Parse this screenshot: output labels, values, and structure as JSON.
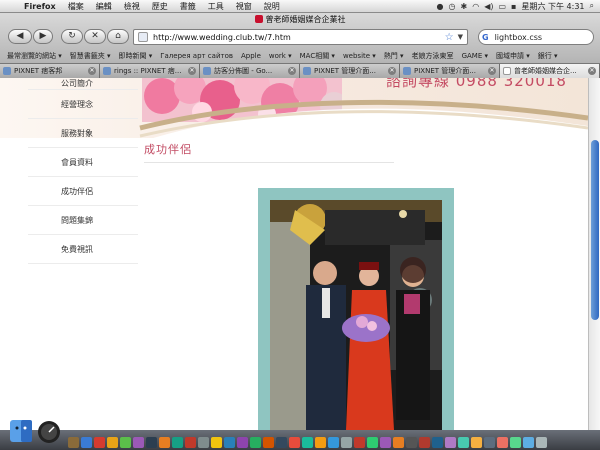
{
  "menubar": {
    "apple": "",
    "app_name": "Firefox",
    "menus": [
      "檔案",
      "編輯",
      "檢視",
      "歷史",
      "書籤",
      "工具",
      "視窗",
      "說明"
    ],
    "clock": "星期六 下午 4:31"
  },
  "window": {
    "title": "曾老師婚姻媒合企業社"
  },
  "toolbar": {
    "back": "◀",
    "forward": "▶",
    "reload": "↻",
    "stop": "✕",
    "home": "⌂",
    "url": "http://www.wedding.club.tw/7.htm",
    "search_engine": "G",
    "search_query": "lightbox.css"
  },
  "bookmarks": [
    "最常瀏覽的網站 ▾",
    "智慧書籤夾 ▾",
    "即時新聞 ▾",
    "Галерея арт сайтов",
    "Apple",
    "work ▾",
    "MAC相關 ▾",
    "website ▾",
    "熱門 ▾",
    "老娘方泳東室",
    "GAME ▾",
    "國域申請 ▾",
    "銀行 ▾"
  ],
  "tabs": [
    {
      "label": "PIXNET 痞客邦",
      "active": false
    },
    {
      "label": "rings :: PIXNET 痞...",
      "active": false
    },
    {
      "label": "訪客分佈圖 - Go...",
      "active": false
    },
    {
      "label": "PIXNET 管理介面...",
      "active": false
    },
    {
      "label": "PIXNET 管理介面...",
      "active": false
    },
    {
      "label": "曾老師婚姻媒合企...",
      "active": true
    }
  ],
  "site": {
    "hotline": "諮詢專線  0988 320018",
    "nav": [
      "公司簡介",
      "經營理念",
      "服務對象",
      "會員資料",
      "成功伴侶",
      "問題集錦",
      "免費視訊"
    ],
    "page_title": "成功伴侶"
  },
  "colors": {
    "accent": "#c24b63",
    "frame": "#8fc5c1"
  }
}
